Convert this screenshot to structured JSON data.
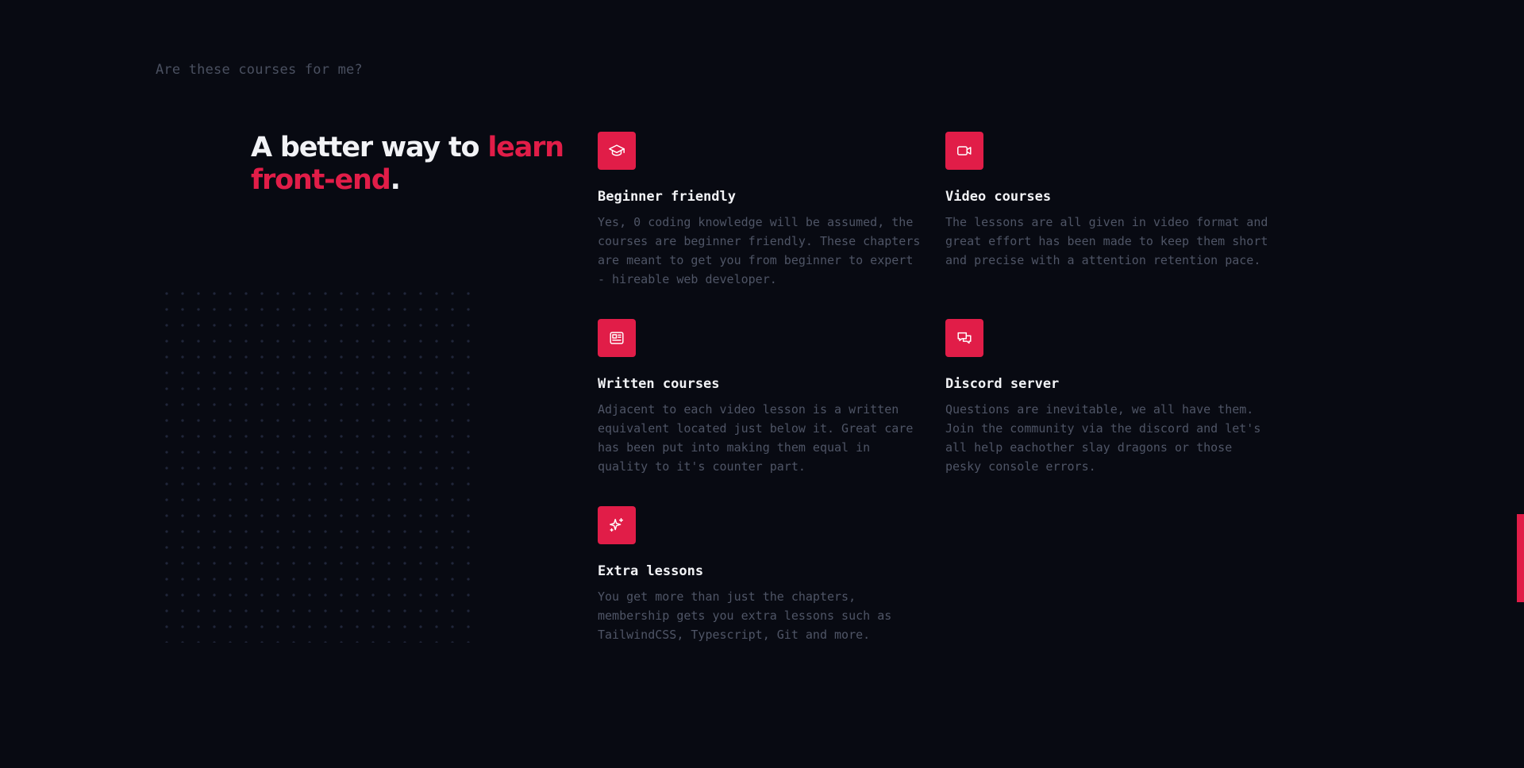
{
  "eyebrow": "Are these courses for me?",
  "headline": {
    "part1": "A better way to ",
    "accent": "learn front-end",
    "end": "."
  },
  "features": [
    {
      "icon": "graduation-cap-icon",
      "title": "Beginner friendly",
      "text": "Yes, 0 coding knowledge will be assumed, the courses are beginner friendly. These chapters are meant to get you from beginner to expert - hireable web developer."
    },
    {
      "icon": "video-camera-icon",
      "title": "Video courses",
      "text": "The lessons are all given in video format and great effort has been made to keep them short and precise with a attention retention pace."
    },
    {
      "icon": "newspaper-icon",
      "title": "Written courses",
      "text": "Adjacent to each video lesson is a written equivalent located just below it. Great care has been put into making them equal in quality to it's counter part."
    },
    {
      "icon": "chat-bubbles-icon",
      "title": "Discord server",
      "text": "Questions are inevitable, we all have them. Join the community via the discord and let's all help eachother slay dragons or those pesky console errors."
    },
    {
      "icon": "sparkles-icon",
      "title": "Extra lessons",
      "text": "You get more than just the chapters, membership gets you extra lessons such as TailwindCSS, Typescript, Git and more."
    }
  ],
  "colors": {
    "background": "#080a12",
    "accent": "#e11d48",
    "heading": "#f2f3f6",
    "muted": "#4f5566"
  }
}
